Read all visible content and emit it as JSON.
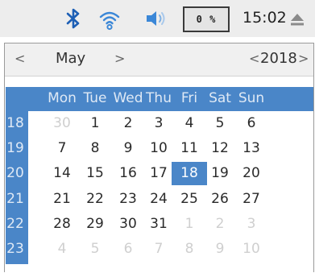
{
  "tray": {
    "icons": [
      "bluetooth-icon",
      "wifi-icon",
      "volume-icon"
    ],
    "cpu_usage": "0 %",
    "clock": "15:02",
    "eject_icon": "eject-icon"
  },
  "calendar": {
    "month": "May",
    "year": "2018",
    "prev_month": "<",
    "next_month": ">",
    "prev_year": "<",
    "next_year": ">",
    "weekdays": [
      "Mon",
      "Tue",
      "Wed",
      "Thu",
      "Fri",
      "Sat",
      "Sun"
    ],
    "weeks": [
      {
        "num": "18",
        "days": [
          "30",
          "1",
          "2",
          "3",
          "4",
          "5",
          "6"
        ]
      },
      {
        "num": "19",
        "days": [
          "7",
          "8",
          "9",
          "10",
          "11",
          "12",
          "13"
        ]
      },
      {
        "num": "20",
        "days": [
          "14",
          "15",
          "16",
          "17",
          "18",
          "19",
          "20"
        ]
      },
      {
        "num": "21",
        "days": [
          "21",
          "22",
          "23",
          "24",
          "25",
          "26",
          "27"
        ]
      },
      {
        "num": "22",
        "days": [
          "28",
          "29",
          "30",
          "31",
          "1",
          "2",
          "3"
        ]
      },
      {
        "num": "23",
        "days": [
          "4",
          "5",
          "6",
          "7",
          "8",
          "9",
          "10"
        ]
      }
    ],
    "selected_day": "18",
    "colors": {
      "accent": "#4a86c8",
      "header_bg": "#f0f0f0",
      "other_month": "#cfcfcf"
    }
  }
}
